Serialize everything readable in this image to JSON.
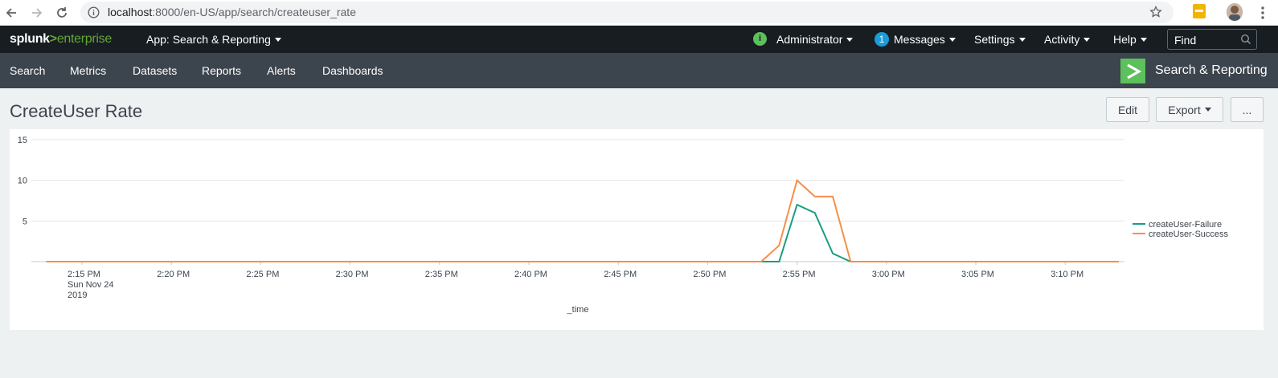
{
  "browser": {
    "url_host": "localhost",
    "url_rest": ":8000/en-US/app/search/createuser_rate"
  },
  "topbar": {
    "logo_part1": "splunk",
    "logo_part2": ">",
    "logo_part3": "enterprise",
    "app_menu": "App: Search & Reporting",
    "status_icon": "i",
    "user": "Administrator",
    "messages_count": "1",
    "messages": "Messages",
    "settings": "Settings",
    "activity": "Activity",
    "help": "Help",
    "find_placeholder": "Find"
  },
  "nav": {
    "items": [
      "Search",
      "Metrics",
      "Datasets",
      "Reports",
      "Alerts",
      "Dashboards"
    ],
    "app_title": "Search & Reporting"
  },
  "page": {
    "title": "CreateUser Rate",
    "edit": "Edit",
    "export": "Export",
    "more": "..."
  },
  "colors": {
    "failure": "#1a9c80",
    "success": "#f58f49"
  },
  "chart_data": {
    "type": "line",
    "xlabel": "_time",
    "ylabel": "",
    "ylim": [
      0,
      15
    ],
    "yticks": [
      5,
      10,
      15
    ],
    "x_tick_labels": [
      "2:15 PM",
      "2:20 PM",
      "2:25 PM",
      "2:30 PM",
      "2:35 PM",
      "2:40 PM",
      "2:45 PM",
      "2:50 PM",
      "2:55 PM",
      "3:00 PM",
      "3:05 PM",
      "3:10 PM"
    ],
    "first_tick_sublabel": [
      "Sun Nov 24",
      "2019"
    ],
    "x_minutes_range": [
      "2:13 PM",
      "3:13 PM"
    ],
    "legend_position": "right",
    "series": [
      {
        "name": "createUser-Failure",
        "points": [
          [
            "2:13 PM",
            0
          ],
          [
            "2:53 PM",
            0
          ],
          [
            "2:54 PM",
            0
          ],
          [
            "2:55 PM",
            7
          ],
          [
            "2:56 PM",
            6
          ],
          [
            "2:57 PM",
            1
          ],
          [
            "2:58 PM",
            0
          ],
          [
            "3:13 PM",
            0
          ]
        ]
      },
      {
        "name": "createUser-Success",
        "points": [
          [
            "2:13 PM",
            0
          ],
          [
            "2:53 PM",
            0
          ],
          [
            "2:54 PM",
            2
          ],
          [
            "2:55 PM",
            10
          ],
          [
            "2:56 PM",
            8
          ],
          [
            "2:57 PM",
            8
          ],
          [
            "2:58 PM",
            0
          ],
          [
            "3:13 PM",
            0
          ]
        ]
      }
    ]
  }
}
